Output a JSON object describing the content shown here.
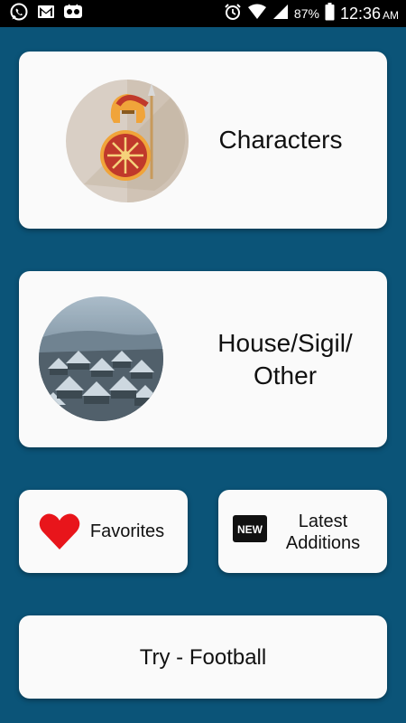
{
  "status_bar": {
    "battery": "87%",
    "time": "12:36",
    "ampm": "AM"
  },
  "cards": {
    "characters": {
      "label": "Characters"
    },
    "house": {
      "line1": "House/Sigil/",
      "line2": "Other"
    },
    "favorites": {
      "label": "Favorites"
    },
    "latest": {
      "line1": "Latest",
      "line2": "Additions"
    },
    "football": {
      "label": "Try - Football"
    }
  },
  "badges": {
    "new": "NEW"
  },
  "icons": {
    "characters": "spartan-helmet-shield-icon",
    "house": "snowy-village-image",
    "favorites": "heart-icon",
    "latest": "new-badge-icon"
  },
  "colors": {
    "background": "#0b5478",
    "card": "#fafafa",
    "heart": "#e8151b"
  }
}
